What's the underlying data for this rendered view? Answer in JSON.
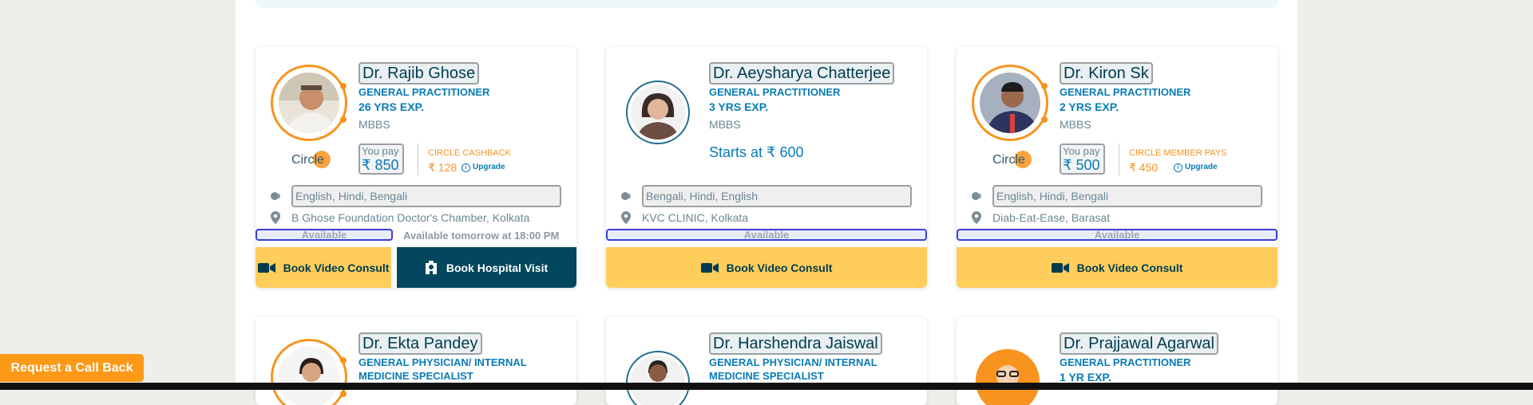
{
  "doctors": [
    {
      "name": "Dr. Rajib Ghose",
      "specialty": "GENERAL PRACTITIONER",
      "experience": "26 YRS EXP.",
      "qualification": "MBBS",
      "circle_logo": "Circle",
      "you_pay_label": "You pay",
      "you_pay_amount": "₹ 850",
      "circle_label": "CIRCLE CASHBACK",
      "circle_amount": "₹ 128",
      "upgrade_label": "Upgrade",
      "languages": "English, Hindi, Bengali",
      "location": "B Ghose Foundation Doctor's Chamber, Kolkata",
      "availability": "Available",
      "availability_detail": "Available tomorrow at 18:00 PM",
      "video_button": "Book Video Consult",
      "hospital_button": "Book Hospital Visit"
    },
    {
      "name": "Dr. Aeysharya Chatterjee",
      "specialty": "GENERAL PRACTITIONER",
      "experience": "3 YRS EXP.",
      "qualification": "MBBS",
      "starts_at": "Starts at ₹ 600",
      "languages": "Bengali, Hindi, English",
      "location": "KVC CLINIC, Kolkata",
      "availability": "Available",
      "video_button": "Book Video Consult"
    },
    {
      "name": "Dr. Kiron Sk",
      "specialty": "GENERAL PRACTITIONER",
      "experience": "2 YRS EXP.",
      "qualification": "MBBS",
      "circle_logo": "Circle",
      "you_pay_label": "You pay",
      "you_pay_amount": "₹ 500",
      "circle_label": "CIRCLE MEMBER PAYS",
      "circle_amount": "₹ 450",
      "upgrade_label": "Upgrade",
      "languages": "English, Hindi, Bengali",
      "location": "Diab-Eat-Ease, Barasat",
      "availability": "Available",
      "video_button": "Book Video Consult"
    },
    {
      "name": "Dr. Ekta Pandey",
      "specialty": "GENERAL PHYSICIAN/ INTERNAL MEDICINE SPECIALIST"
    },
    {
      "name": "Dr. Harshendra Jaiswal",
      "specialty": "GENERAL PHYSICIAN/ INTERNAL MEDICINE SPECIALIST"
    },
    {
      "name": "Dr. Prajjawal Agarwal",
      "specialty": "GENERAL PRACTITIONER",
      "experience": "1 YR EXP."
    }
  ],
  "callback_button": "Request a Call Back",
  "icons": {
    "language": "speech-icon",
    "location": "map-pin-icon",
    "video": "video-camera-icon",
    "hospital": "hospital-building-icon"
  },
  "colors": {
    "accent_orange": "#f7931e",
    "primary_blue": "#0a7bb5",
    "dark_teal": "#02475e",
    "button_yellow": "#fecd5b"
  }
}
